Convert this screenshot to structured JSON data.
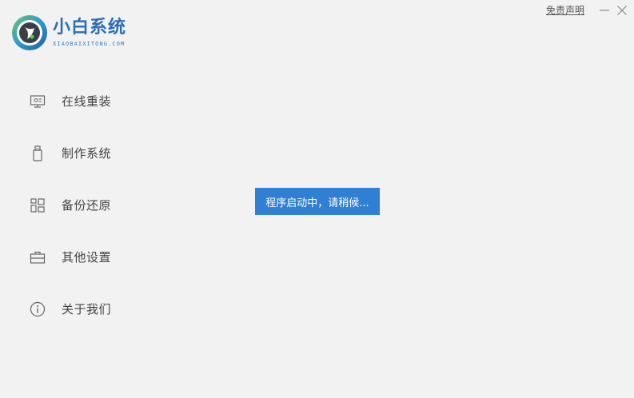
{
  "app": {
    "title": "小白系统",
    "subtitle": "XIAOBAIXITONG.COM",
    "logo_icon": "xiaobai-logo"
  },
  "topbar": {
    "disclaimer_label": "免责声明",
    "minimize_icon": "minimize-icon",
    "close_icon": "close-icon"
  },
  "sidebar": {
    "items": [
      {
        "label": "在线重装",
        "icon": "monitor-icon"
      },
      {
        "label": "制作系统",
        "icon": "usb-drive-icon"
      },
      {
        "label": "备份还原",
        "icon": "grid-icon"
      },
      {
        "label": "其他设置",
        "icon": "toolbox-icon"
      },
      {
        "label": "关于我们",
        "icon": "info-icon"
      }
    ]
  },
  "toast": {
    "message": "程序启动中，请稍候..."
  },
  "colors": {
    "background": "#f2f2f2",
    "brand": "#2a6fb5",
    "toast_bg": "#2f7fd3",
    "nav_text": "#444444"
  }
}
